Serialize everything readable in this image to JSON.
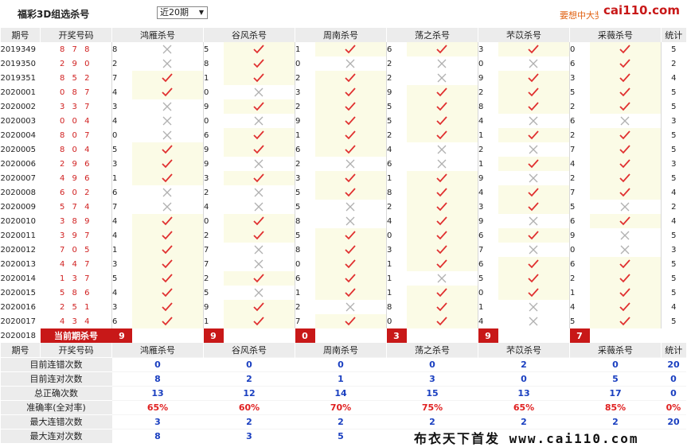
{
  "header": {
    "title": "福彩3D组选杀号",
    "period_select": "近20期",
    "marquee": "要想中大奖",
    "logo": "cai110.com"
  },
  "columns": {
    "issue": "期号",
    "numbers": "开奖号码",
    "methods": [
      "鸿雁杀号",
      "谷风杀号",
      "周南杀号",
      "荡之杀号",
      "芣苡杀号",
      "采薇杀号"
    ],
    "total": "统计"
  },
  "rows": [
    {
      "issue": "2019349",
      "nums": "878",
      "kills": [
        8,
        5,
        1,
        6,
        3,
        0
      ],
      "hits": [
        0,
        1,
        1,
        1,
        1,
        1
      ],
      "total": 5
    },
    {
      "issue": "2019350",
      "nums": "290",
      "kills": [
        2,
        8,
        0,
        2,
        0,
        6
      ],
      "hits": [
        0,
        1,
        0,
        0,
        0,
        1
      ],
      "total": 2
    },
    {
      "issue": "2019351",
      "nums": "852",
      "kills": [
        7,
        1,
        2,
        2,
        9,
        3
      ],
      "hits": [
        1,
        1,
        1,
        0,
        1,
        1
      ],
      "total": 4
    },
    {
      "issue": "2020001",
      "nums": "087",
      "kills": [
        4,
        0,
        3,
        9,
        2,
        5
      ],
      "hits": [
        1,
        0,
        1,
        1,
        1,
        1
      ],
      "total": 5
    },
    {
      "issue": "2020002",
      "nums": "337",
      "kills": [
        3,
        9,
        2,
        5,
        8,
        2
      ],
      "hits": [
        0,
        1,
        1,
        1,
        1,
        1
      ],
      "total": 5
    },
    {
      "issue": "2020003",
      "nums": "004",
      "kills": [
        4,
        0,
        9,
        5,
        4,
        6
      ],
      "hits": [
        0,
        0,
        1,
        1,
        0,
        0
      ],
      "total": 3
    },
    {
      "issue": "2020004",
      "nums": "807",
      "kills": [
        0,
        6,
        1,
        2,
        1,
        2
      ],
      "hits": [
        0,
        1,
        1,
        1,
        1,
        1
      ],
      "total": 5
    },
    {
      "issue": "2020005",
      "nums": "804",
      "kills": [
        5,
        9,
        6,
        4,
        2,
        7
      ],
      "hits": [
        1,
        1,
        1,
        0,
        0,
        1
      ],
      "total": 5
    },
    {
      "issue": "2020006",
      "nums": "296",
      "kills": [
        3,
        9,
        2,
        6,
        1,
        4
      ],
      "hits": [
        1,
        0,
        0,
        0,
        1,
        1
      ],
      "total": 3
    },
    {
      "issue": "2020007",
      "nums": "496",
      "kills": [
        1,
        3,
        3,
        1,
        9,
        2
      ],
      "hits": [
        1,
        1,
        1,
        1,
        0,
        1
      ],
      "total": 5
    },
    {
      "issue": "2020008",
      "nums": "602",
      "kills": [
        6,
        2,
        5,
        8,
        4,
        7
      ],
      "hits": [
        0,
        0,
        1,
        1,
        1,
        1
      ],
      "total": 4
    },
    {
      "issue": "2020009",
      "nums": "574",
      "kills": [
        7,
        4,
        5,
        2,
        3,
        5
      ],
      "hits": [
        0,
        0,
        0,
        1,
        1,
        0
      ],
      "total": 2
    },
    {
      "issue": "2020010",
      "nums": "389",
      "kills": [
        4,
        0,
        8,
        4,
        9,
        6
      ],
      "hits": [
        1,
        1,
        0,
        1,
        0,
        1
      ],
      "total": 4
    },
    {
      "issue": "2020011",
      "nums": "397",
      "kills": [
        4,
        2,
        5,
        0,
        6,
        9
      ],
      "hits": [
        1,
        1,
        1,
        1,
        1,
        0
      ],
      "total": 5
    },
    {
      "issue": "2020012",
      "nums": "705",
      "kills": [
        1,
        7,
        8,
        3,
        7,
        0
      ],
      "hits": [
        1,
        0,
        1,
        1,
        0,
        0
      ],
      "total": 3
    },
    {
      "issue": "2020013",
      "nums": "447",
      "kills": [
        3,
        7,
        0,
        1,
        6,
        6
      ],
      "hits": [
        1,
        0,
        1,
        1,
        1,
        1
      ],
      "total": 5
    },
    {
      "issue": "2020014",
      "nums": "137",
      "kills": [
        5,
        2,
        6,
        1,
        5,
        2
      ],
      "hits": [
        1,
        1,
        1,
        0,
        1,
        1
      ],
      "total": 5
    },
    {
      "issue": "2020015",
      "nums": "586",
      "kills": [
        4,
        5,
        1,
        1,
        0,
        1
      ],
      "hits": [
        1,
        0,
        1,
        1,
        1,
        1
      ],
      "total": 5
    },
    {
      "issue": "2020016",
      "nums": "251",
      "kills": [
        3,
        9,
        2,
        8,
        1,
        4
      ],
      "hits": [
        1,
        1,
        0,
        1,
        0,
        1
      ],
      "total": 4
    },
    {
      "issue": "2020017",
      "nums": "434",
      "kills": [
        6,
        1,
        7,
        0,
        4,
        5
      ],
      "hits": [
        1,
        1,
        1,
        1,
        0,
        1
      ],
      "total": 5
    }
  ],
  "current": {
    "issue": "2020018",
    "label": "当前期杀号",
    "kills": [
      9,
      9,
      0,
      3,
      9,
      7
    ]
  },
  "stats": [
    {
      "label": "目前连错次数",
      "values": [
        "0",
        "0",
        "0",
        "0",
        "2",
        "0"
      ],
      "total": "20"
    },
    {
      "label": "目前连对次数",
      "values": [
        "8",
        "2",
        "1",
        "3",
        "0",
        "5"
      ],
      "total": "0"
    },
    {
      "label": "总正确次数",
      "values": [
        "13",
        "12",
        "14",
        "15",
        "13",
        "17"
      ],
      "total": "0"
    },
    {
      "label": "准确率(全对率)",
      "values": [
        "65%",
        "60%",
        "70%",
        "75%",
        "65%",
        "85%"
      ],
      "total": "0%"
    },
    {
      "label": "最大连错次数",
      "values": [
        "3",
        "2",
        "2",
        "2",
        "2",
        "2"
      ],
      "total": "20"
    },
    {
      "label": "最大连对次数",
      "values": [
        "8",
        "3",
        "5",
        "",
        "",
        ""
      ],
      "total": ""
    }
  ],
  "footer": {
    "brand": "布衣天下首发 www.cai110.com"
  },
  "colors": {
    "check": "#e03030",
    "cross": "#b0b0b0",
    "current_bg": "#c81818",
    "stat_value": "#1a3fc0",
    "stat_percent": "#e02020"
  }
}
